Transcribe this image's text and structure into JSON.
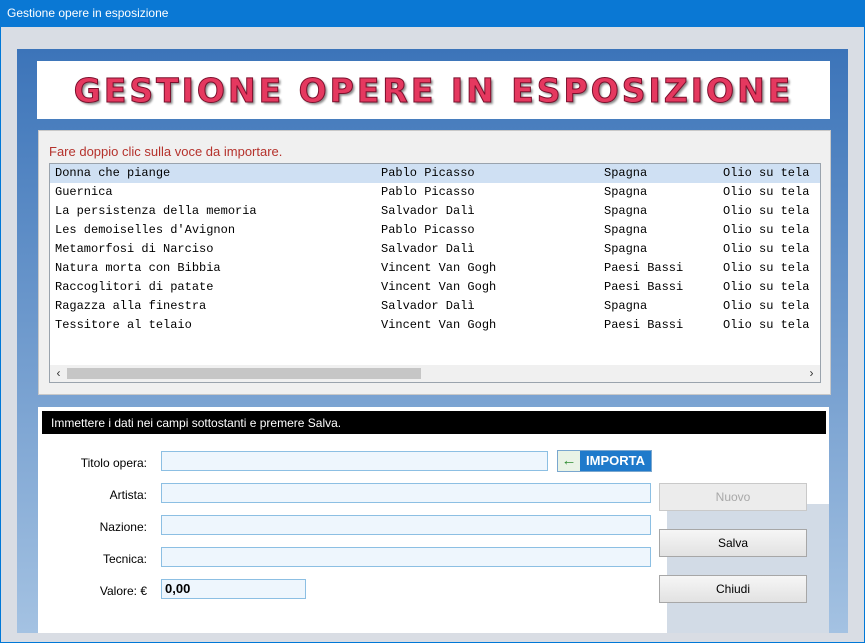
{
  "window": {
    "title": "Gestione opere in esposizione"
  },
  "banner": {
    "text": "GESTIONE OPERE IN ESPOSIZIONE"
  },
  "list": {
    "hint": "Fare doppio clic sulla voce da importare.",
    "rows": [
      [
        "Donna che piange",
        "Pablo Picasso",
        "Spagna",
        "Olio su tela"
      ],
      [
        "Guernica",
        "Pablo Picasso",
        "Spagna",
        "Olio su tela"
      ],
      [
        "La persistenza della memoria",
        "Salvador Dalì",
        "Spagna",
        "Olio su tela"
      ],
      [
        "Les demoiselles d'Avignon",
        "Pablo Picasso",
        "Spagna",
        "Olio su tela"
      ],
      [
        "Metamorfosi di Narciso",
        "Salvador Dalì",
        "Spagna",
        "Olio su tela"
      ],
      [
        "Natura morta con Bibbia",
        "Vincent Van Gogh",
        "Paesi Bassi",
        "Olio su tela"
      ],
      [
        "Raccoglitori di patate",
        "Vincent Van Gogh",
        "Paesi Bassi",
        "Olio su tela"
      ],
      [
        "Ragazza alla finestra",
        "Salvador Dalì",
        "Spagna",
        "Olio su tela"
      ],
      [
        "Tessitore al telaio",
        "Vincent Van Gogh",
        "Paesi Bassi",
        "Olio su tela"
      ]
    ],
    "selected_index": 0,
    "scroll_left_icon": "chevron-left-icon",
    "scroll_right_icon": "chevron-right-icon",
    "scroll_left_glyph": "‹",
    "scroll_right_glyph": "›"
  },
  "form": {
    "instruction": "Immettere i dati nei campi sottostanti e premere Salva.",
    "fields": {
      "title_label": "Titolo opera:",
      "title_value": "",
      "artist_label": "Artista:",
      "artist_value": "",
      "nation_label": "Nazione:",
      "nation_value": "",
      "technique_label": "Tecnica:",
      "technique_value": "",
      "value_label": "Valore: €",
      "value_value": "0,00"
    },
    "import_button": {
      "label": "IMPORTA",
      "arrow_glyph": "←",
      "icon": "arrow-left-icon"
    }
  },
  "buttons": {
    "new": "Nuovo",
    "save": "Salva",
    "close": "Chiudi",
    "new_enabled": false
  },
  "colors": {
    "accent": "#0a78d4",
    "hint": "#b5322c",
    "selection": "#cfe0f3"
  }
}
